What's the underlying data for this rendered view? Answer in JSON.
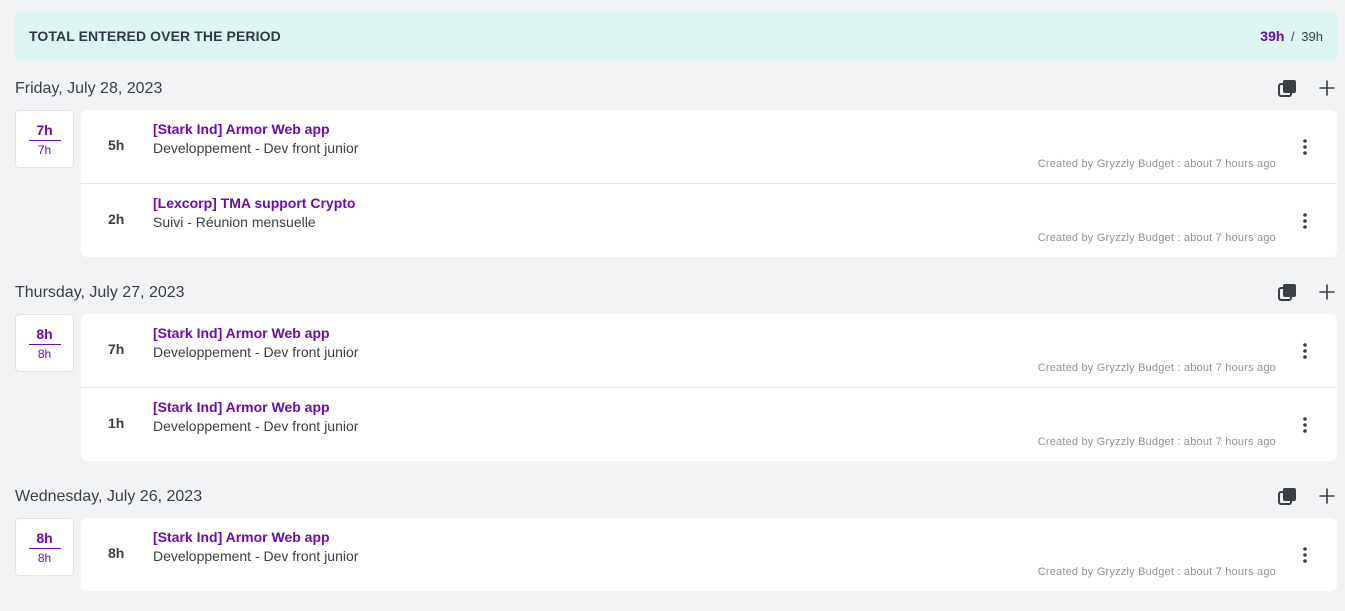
{
  "summary": {
    "label": "TOTAL ENTERED OVER THE PERIOD",
    "entered": "39h",
    "separator": "/",
    "expected": "39h"
  },
  "colors": {
    "accent": "#6b0dab",
    "summary_bg": "#dcf5f1",
    "page_bg": "#f2f3f5"
  },
  "days": [
    {
      "date": "Friday, July 28, 2023",
      "entered": "7h",
      "expected": "7h",
      "entries": [
        {
          "hours": "5h",
          "project": "[Stark Ind] Armor Web app",
          "task": "Developpement - Dev front junior",
          "meta": "Created by Gryzzly Budget : about 7 hours ago"
        },
        {
          "hours": "2h",
          "project": "[Lexcorp] TMA support Crypto",
          "task": "Suivi - Réunion mensuelle",
          "meta": "Created by Gryzzly Budget : about 7 hours ago"
        }
      ]
    },
    {
      "date": "Thursday, July 27, 2023",
      "entered": "8h",
      "expected": "8h",
      "entries": [
        {
          "hours": "7h",
          "project": "[Stark Ind] Armor Web app",
          "task": "Developpement - Dev front junior",
          "meta": "Created by Gryzzly Budget : about 7 hours ago"
        },
        {
          "hours": "1h",
          "project": "[Stark Ind] Armor Web app",
          "task": "Developpement - Dev front junior",
          "meta": "Created by Gryzzly Budget : about 7 hours ago"
        }
      ]
    },
    {
      "date": "Wednesday, July 26, 2023",
      "entered": "8h",
      "expected": "8h",
      "entries": [
        {
          "hours": "8h",
          "project": "[Stark Ind] Armor Web app",
          "task": "Developpement - Dev front junior",
          "meta": "Created by Gryzzly Budget : about 7 hours ago"
        }
      ]
    }
  ],
  "icons": {
    "duplicate": "duplicate-icon",
    "add": "plus-icon",
    "menu": "more-vertical-icon"
  }
}
